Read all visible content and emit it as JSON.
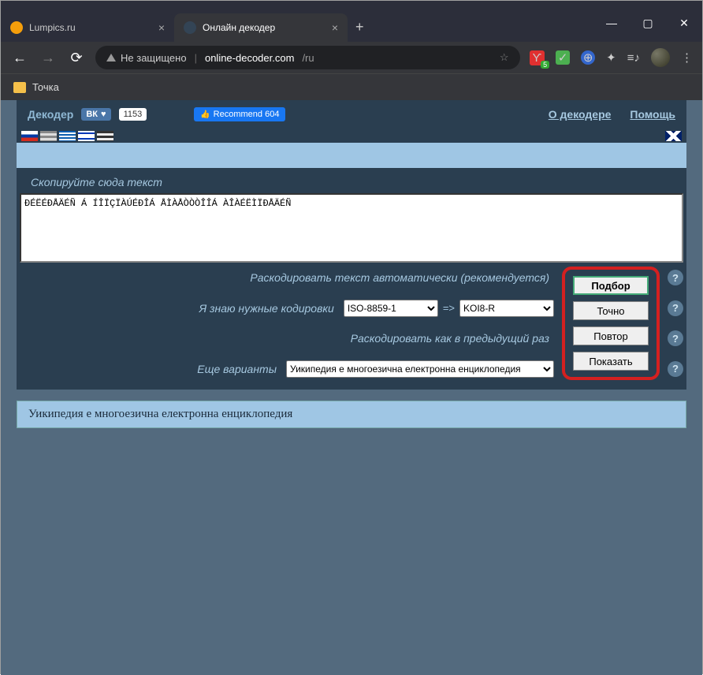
{
  "titlebar": {
    "tabs": [
      {
        "title": "Lumpics.ru",
        "active": false
      },
      {
        "title": "Онлайн декодер",
        "active": true
      }
    ]
  },
  "toolbar": {
    "security_text": "Не защищено",
    "url_host": "online-decoder.com",
    "url_path": "/ru"
  },
  "bookmarks": {
    "items": [
      {
        "label": "Точка"
      }
    ]
  },
  "header": {
    "brand": "Декодер",
    "vk_label": "ВК",
    "vk_count": "1153",
    "fb_label": "Recommend 604",
    "links": {
      "about": "О декодере",
      "help": "Помощь"
    }
  },
  "decoder": {
    "tab_label": "Скопируйте сюда текст",
    "input_text": "ÐÉËÉÐÅÄÉÑ Á ÍÎÏÇÏÀÚÉÐÎÁ ÅÌÀÅÒÒÒÎÎÁ ÀÎÀÉËÌÏÐÅÄÉÑ",
    "rows": {
      "auto": {
        "label": "Раскодировать текст автоматически (рекомендуется)",
        "button": "Подбор"
      },
      "encodings": {
        "label": "Я знаю нужные кодировки",
        "from": "ISO-8859-1",
        "to": "KOI8-R",
        "button": "Точно"
      },
      "repeat": {
        "label": "Раскодировать как в предыдущий раз",
        "button": "Повтор"
      },
      "variants": {
        "label": "Еще варианты",
        "selected": "Уикипедия е многоезична електронна енциклопедия",
        "button": "Показать"
      }
    }
  },
  "result": {
    "text": "Уикипедия е многоезична електронна енциклопедия"
  }
}
